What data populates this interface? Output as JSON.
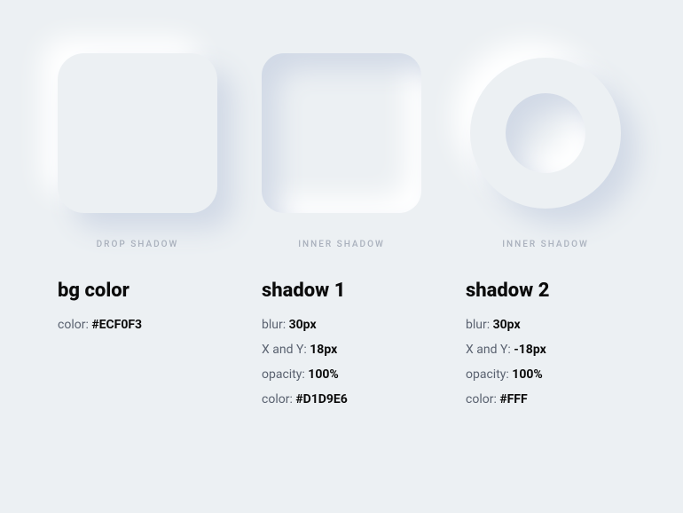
{
  "shapes": [
    {
      "label": "DROP SHADOW"
    },
    {
      "label": "INNER SHADOW"
    },
    {
      "label": "INNER SHADOW"
    }
  ],
  "specs": [
    {
      "title": "bg color",
      "lines": [
        {
          "key": "color",
          "value": "#ECF0F3"
        }
      ]
    },
    {
      "title": "shadow 1",
      "lines": [
        {
          "key": "blur",
          "value": "30px"
        },
        {
          "key": "X and Y",
          "value": "18px"
        },
        {
          "key": "opacity",
          "value": "100%"
        },
        {
          "key": "color",
          "value": "#D1D9E6"
        }
      ]
    },
    {
      "title": "shadow 2",
      "lines": [
        {
          "key": "blur",
          "value": "30px"
        },
        {
          "key": "X and Y",
          "value": "-18px"
        },
        {
          "key": "opacity",
          "value": "100%"
        },
        {
          "key": "color",
          "value": "#FFF"
        }
      ]
    }
  ]
}
